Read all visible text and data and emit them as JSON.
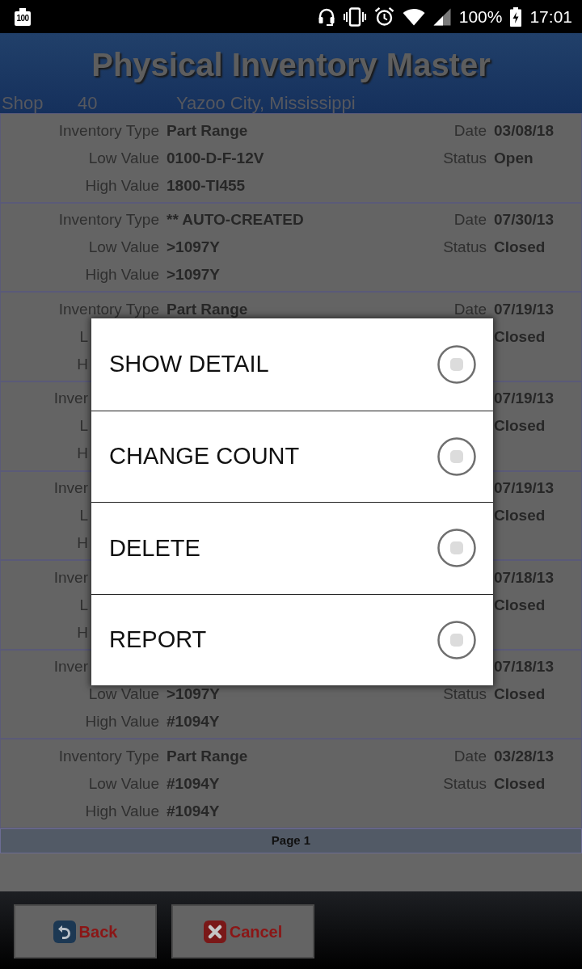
{
  "status_bar": {
    "notification_badge": "100",
    "battery": "100%",
    "time": "17:01"
  },
  "header": {
    "title": "Physical Inventory Master",
    "shop_label": "Shop",
    "shop_number": "40",
    "shop_location": "Yazoo City, Mississippi"
  },
  "records": [
    {
      "lines": [
        {
          "kind": "full",
          "label": "Inventory Type",
          "value": "Part Range",
          "side_label": "Date",
          "side_value": "03/08/18"
        },
        {
          "kind": "full",
          "label": "Low Value",
          "value": "0100-D-F-12V",
          "side_label": "Status",
          "side_value": "Open"
        },
        {
          "kind": "full",
          "label": "High Value",
          "value": "1800-TI455"
        }
      ]
    },
    {
      "lines": [
        {
          "kind": "full",
          "label": "Inventory Type",
          "value": "** AUTO-CREATED",
          "side_label": "Date",
          "side_value": "07/30/13"
        },
        {
          "kind": "full",
          "label": "Low Value",
          "value": ">1097Y",
          "side_label": "Status",
          "side_value": "Closed"
        },
        {
          "kind": "full",
          "label": "High Value",
          "value": ">1097Y"
        }
      ]
    },
    {
      "lines": [
        {
          "kind": "full",
          "label": "Inventory Type",
          "value": "Part Range",
          "side_label": "Date",
          "side_value": "07/19/13"
        },
        {
          "kind": "cut",
          "label": "L",
          "side_value": "Closed"
        },
        {
          "kind": "cut",
          "label": "H"
        }
      ]
    },
    {
      "lines": [
        {
          "kind": "cut",
          "label": "Inver",
          "side_value": "07/19/13"
        },
        {
          "kind": "cut",
          "label": "L",
          "side_value": "Closed"
        },
        {
          "kind": "cut",
          "label": "H"
        }
      ]
    },
    {
      "lines": [
        {
          "kind": "cut",
          "label": "Inver",
          "side_value": "07/19/13"
        },
        {
          "kind": "cut",
          "label": "L",
          "side_value": "Closed"
        },
        {
          "kind": "cut",
          "label": "H"
        }
      ]
    },
    {
      "lines": [
        {
          "kind": "cut",
          "label": "Inver",
          "side_value": "07/18/13"
        },
        {
          "kind": "cut",
          "label": "L",
          "side_value": "Closed"
        },
        {
          "kind": "cut",
          "label": "H"
        }
      ]
    },
    {
      "lines": [
        {
          "kind": "cut",
          "label": "Inver",
          "side_value": "07/18/13"
        },
        {
          "kind": "full",
          "label": "Low Value",
          "value": ">1097Y",
          "side_label": "Status",
          "side_value": "Closed"
        },
        {
          "kind": "full",
          "label": "High Value",
          "value": "#1094Y"
        }
      ]
    },
    {
      "lines": [
        {
          "kind": "full",
          "label": "Inventory Type",
          "value": "Part Range",
          "side_label": "Date",
          "side_value": "03/28/13"
        },
        {
          "kind": "full",
          "label": "Low Value",
          "value": "#1094Y",
          "side_label": "Status",
          "side_value": "Closed"
        },
        {
          "kind": "full",
          "label": "High Value",
          "value": "#1094Y"
        }
      ]
    }
  ],
  "pager": {
    "label": "Page 1"
  },
  "dialog": {
    "options": [
      {
        "label": "SHOW DETAIL",
        "selected": false
      },
      {
        "label": "CHANGE COUNT",
        "selected": false
      },
      {
        "label": "DELETE",
        "selected": false
      },
      {
        "label": "REPORT",
        "selected": false
      }
    ]
  },
  "buttons": [
    {
      "kind": "back",
      "label": "Back"
    },
    {
      "kind": "cancel",
      "label": "Cancel"
    }
  ]
}
